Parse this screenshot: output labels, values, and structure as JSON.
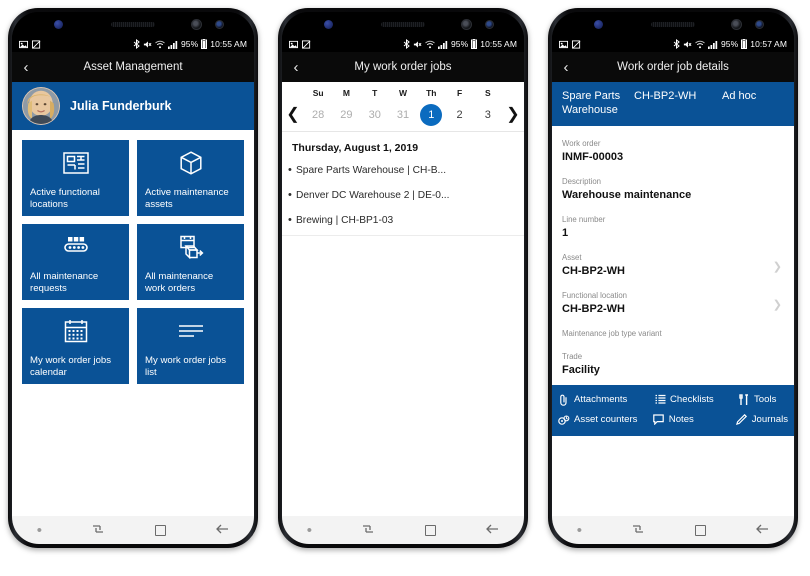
{
  "status_bar": {
    "left_icons": [
      "image-icon",
      "screenshot-icon"
    ],
    "right_icons": [
      "bluetooth-icon",
      "mute-icon",
      "wifi-icon",
      "signal-icon",
      "battery-icon"
    ],
    "battery_percent": "95%",
    "time_1": "10:55 AM",
    "time_2": "10:55 AM",
    "time_3": "10:57 AM"
  },
  "nav_bar": {
    "recents_label": "recents",
    "home_label": "home",
    "back_label": "back"
  },
  "colors": {
    "brand_blue": "#0a5296",
    "accent_blue": "#0b6bbf",
    "app_bar": "#0a0a0a"
  },
  "phone1": {
    "title": "Asset Management",
    "back_icon": "chevron-left-icon",
    "user": {
      "name": "Julia Funderburk",
      "avatar": "user-photo"
    },
    "tiles": [
      {
        "label": "Active functional locations",
        "icon": "floor-plan-icon"
      },
      {
        "label": "Active maintenance assets",
        "icon": "box-icon"
      },
      {
        "label": "All maintenance requests",
        "icon": "conveyor-icon"
      },
      {
        "label": "All maintenance work orders",
        "icon": "work-order-icon"
      },
      {
        "label": "My work order jobs calendar",
        "icon": "calendar-icon"
      },
      {
        "label": "My work order jobs list",
        "icon": "list-icon"
      }
    ]
  },
  "phone2": {
    "title": "My work order jobs",
    "back_icon": "chevron-left-icon",
    "calendar": {
      "prev_icon": "chevron-left-icon",
      "next_icon": "chevron-right-icon",
      "day_headers": [
        "Su",
        "M",
        "T",
        "W",
        "Th",
        "F",
        "S"
      ],
      "days": [
        {
          "n": "28",
          "state": "other"
        },
        {
          "n": "29",
          "state": "other"
        },
        {
          "n": "30",
          "state": "other"
        },
        {
          "n": "31",
          "state": "other"
        },
        {
          "n": "1",
          "state": "selected"
        },
        {
          "n": "2",
          "state": "current"
        },
        {
          "n": "3",
          "state": "current"
        }
      ]
    },
    "date_title": "Thursday, August 1, 2019",
    "jobs": [
      "Spare Parts Warehouse | CH-B...",
      "Denver DC Warehouse 2 | DE-0...",
      "Brewing | CH-BP1-03"
    ]
  },
  "phone3": {
    "title": "Work order job details",
    "back_icon": "chevron-left-icon",
    "header_cols": [
      "Spare Parts Warehouse",
      "CH-BP2-WH",
      "Ad hoc"
    ],
    "fields": [
      {
        "label": "Work order",
        "value": "INMF-00003",
        "chevron": false
      },
      {
        "label": "Description",
        "value": "Warehouse maintenance",
        "chevron": false
      },
      {
        "label": "Line number",
        "value": "1",
        "chevron": false
      },
      {
        "label": "Asset",
        "value": "CH-BP2-WH",
        "chevron": true
      },
      {
        "label": "Functional location",
        "value": "CH-BP2-WH",
        "chevron": true
      },
      {
        "label": "Maintenance job type variant",
        "value": "",
        "chevron": false
      },
      {
        "label": "Trade",
        "value": "Facility",
        "chevron": false
      }
    ],
    "actions_row1": [
      {
        "label": "Attachments",
        "icon": "paperclip-icon"
      },
      {
        "label": "Checklists",
        "icon": "checklist-icon"
      },
      {
        "label": "Tools",
        "icon": "tools-icon"
      }
    ],
    "actions_row2": [
      {
        "label": "Asset counters",
        "icon": "counter-icon"
      },
      {
        "label": "Notes",
        "icon": "note-icon"
      },
      {
        "label": "Journals",
        "icon": "pencil-icon"
      }
    ]
  }
}
